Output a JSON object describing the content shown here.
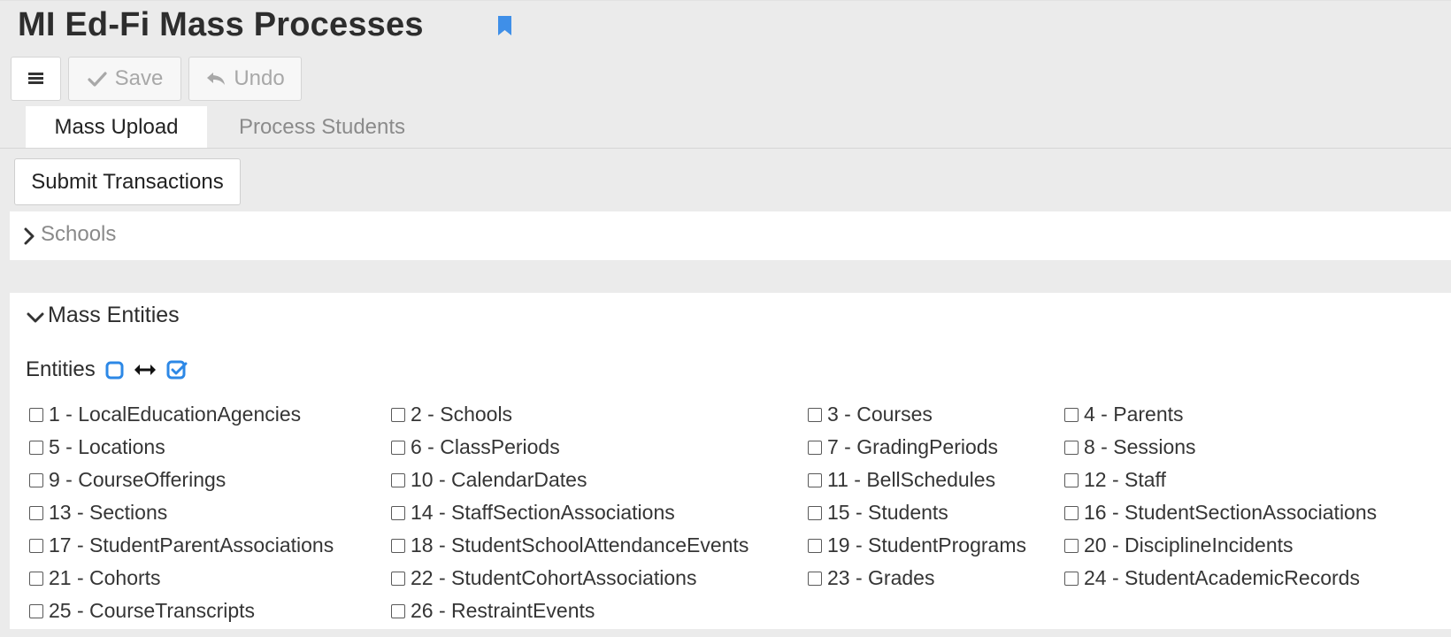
{
  "page": {
    "title": "MI Ed-Fi Mass Processes",
    "bookmark_icon": "bookmark-icon",
    "accent_color": "#3f8fe8"
  },
  "toolbar": {
    "menu_icon": "menu-icon",
    "save_label": "Save",
    "undo_label": "Undo"
  },
  "tabs": [
    {
      "label": "Mass Upload",
      "active": true
    },
    {
      "label": "Process Students",
      "active": false
    }
  ],
  "actions": {
    "submit_label": "Submit Transactions"
  },
  "schools_panel": {
    "label": "Schools",
    "expanded": false
  },
  "mass_entities": {
    "title": "Mass Entities",
    "expanded": true,
    "entities_label": "Entities",
    "items": [
      "1 - LocalEducationAgencies",
      "2 - Schools",
      "3 - Courses",
      "4 - Parents",
      "5 - Locations",
      "6 - ClassPeriods",
      "7 - GradingPeriods",
      "8 - Sessions",
      "9 - CourseOfferings",
      "10 - CalendarDates",
      "11 - BellSchedules",
      "12 - Staff",
      "13 - Sections",
      "14 - StaffSectionAssociations",
      "15 - Students",
      "16 - StudentSectionAssociations",
      "17 - StudentParentAssociations",
      "18 - StudentSchoolAttendanceEvents",
      "19 - StudentPrograms",
      "20 - DisciplineIncidents",
      "21 - Cohorts",
      "22 - StudentCohortAssociations",
      "23 - Grades",
      "24 - StudentAcademicRecords",
      "25 - CourseTranscripts",
      "26 - RestraintEvents"
    ]
  }
}
